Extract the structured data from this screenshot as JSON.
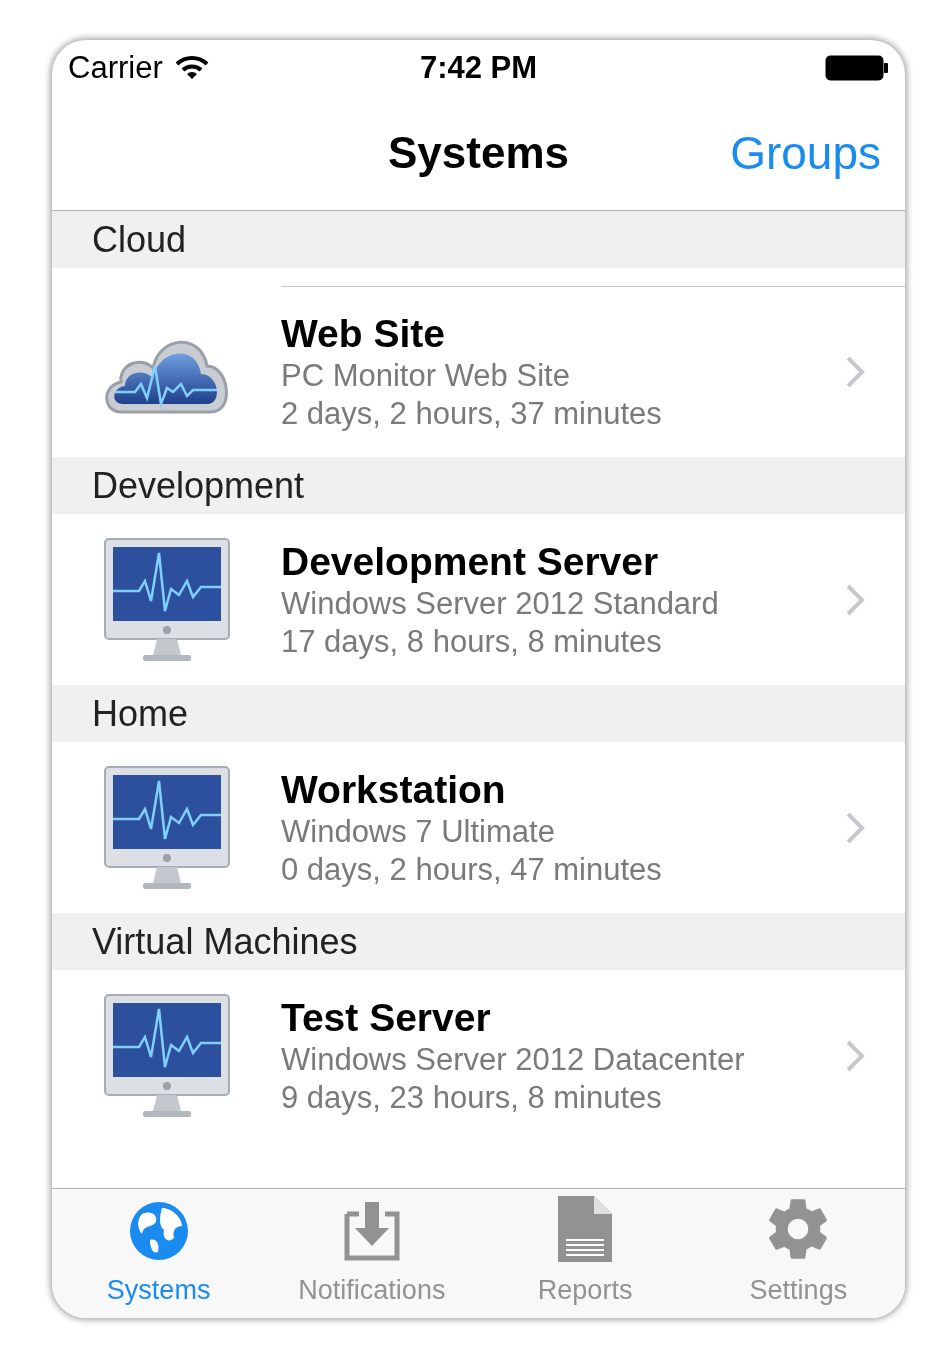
{
  "status_bar": {
    "carrier": "Carrier",
    "time": "7:42 PM"
  },
  "nav_bar": {
    "title": "Systems",
    "right_button": "Groups"
  },
  "sections": [
    {
      "title": "Cloud",
      "rows": [
        {
          "kind": "cloud",
          "name": "Web Site",
          "description": "PC Monitor Web Site",
          "uptime": "2 days, 2 hours, 37 minutes"
        }
      ]
    },
    {
      "title": "Development",
      "rows": [
        {
          "kind": "monitor",
          "name": "Development Server",
          "description": "Windows Server 2012 Standard",
          "uptime": "17 days, 8 hours, 8 minutes"
        }
      ]
    },
    {
      "title": "Home",
      "rows": [
        {
          "kind": "monitor",
          "name": "Workstation",
          "description": "Windows 7 Ultimate",
          "uptime": "0 days, 2 hours, 47 minutes"
        }
      ]
    },
    {
      "title": "Virtual Machines",
      "rows": [
        {
          "kind": "monitor",
          "name": "Test Server",
          "description": "Windows Server 2012 Datacenter",
          "uptime": "9 days, 23 hours, 8 minutes"
        }
      ]
    }
  ],
  "tab_bar": [
    {
      "kind": "globe",
      "label": "Systems",
      "selected": true
    },
    {
      "kind": "download",
      "label": "Notifications",
      "selected": false
    },
    {
      "kind": "document",
      "label": "Reports",
      "selected": false
    },
    {
      "kind": "gear",
      "label": "Settings",
      "selected": false
    }
  ]
}
